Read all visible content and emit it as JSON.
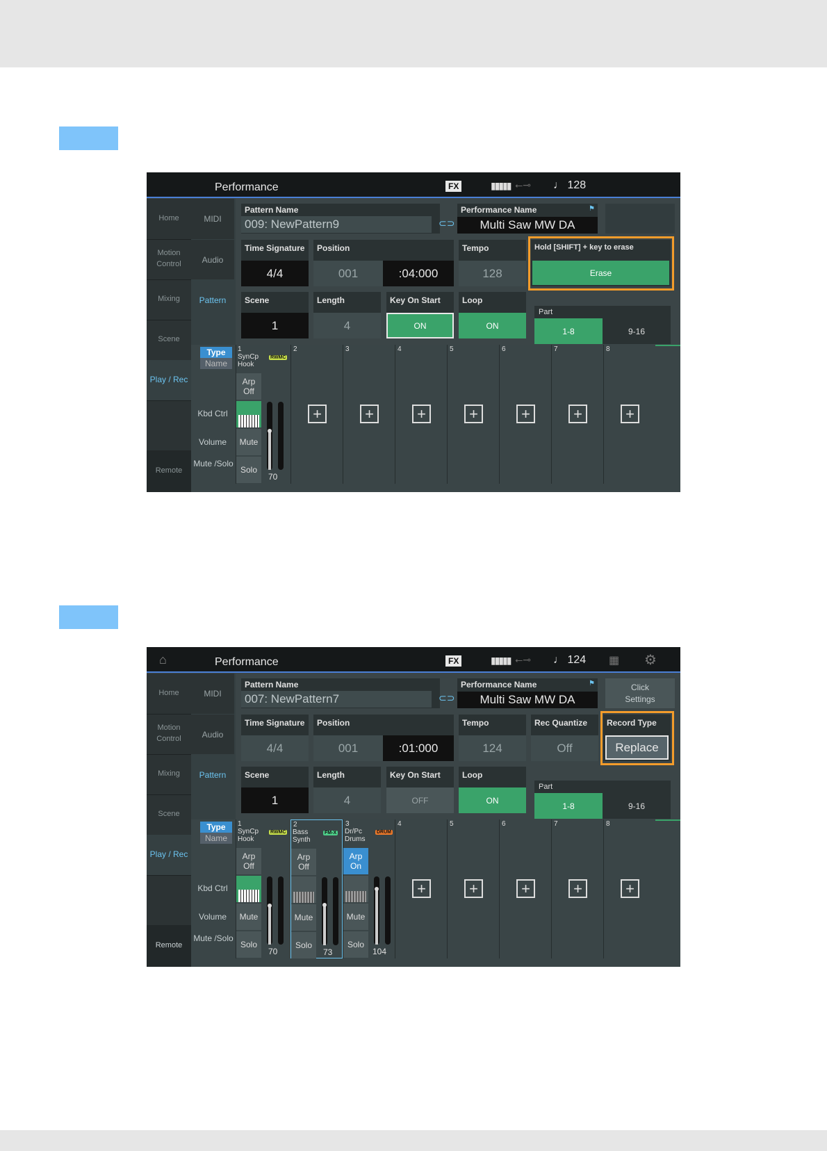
{
  "screen1": {
    "title": "Performance",
    "fx_label": "FX",
    "tempo_display": "♩ 128",
    "nav": [
      "Home",
      "Motion Control",
      "Mixing",
      "Scene",
      "Play / Rec",
      "Remote"
    ],
    "subnav": [
      "MIDI",
      "Audio",
      "Pattern"
    ],
    "pattern_name_label": "Pattern Name",
    "pattern_name": "009: NewPattern9",
    "performance_name_label": "Performance Name",
    "performance_name": "Multi Saw MW DA",
    "time_signature_label": "Time Signature",
    "time_signature": "4/4",
    "position_label": "Position",
    "position_measure": "001",
    "position_time": ":04:000",
    "tempo_label": "Tempo",
    "tempo": "128",
    "erase_hint": "Hold [SHIFT] + key to erase",
    "erase_button": "Erase",
    "scene_label": "Scene",
    "scene": "1",
    "length_label": "Length",
    "length": "4",
    "key_on_start_label": "Key On Start",
    "key_on_start": "ON",
    "loop_label": "Loop",
    "loop": "ON",
    "part_label": "Part",
    "part_1_8": "1-8",
    "part_9_16": "9-16",
    "type_label": "Type",
    "name_label": "Name",
    "row_labels": [
      "Kbd Ctrl",
      "Volume",
      "Mute /Solo"
    ],
    "part1": {
      "num": "1",
      "name": "SynCp Hook",
      "badge": "RWMC",
      "arp": "Arp Off",
      "mute": "Mute",
      "solo": "Solo",
      "volume": "70"
    },
    "empty_parts": [
      "2",
      "3",
      "4",
      "5",
      "6",
      "7",
      "8"
    ]
  },
  "screen2": {
    "title": "Performance",
    "fx_label": "FX",
    "tempo_display": "♩ 124",
    "nav": [
      "Home",
      "Motion Control",
      "Mixing",
      "Scene",
      "Play / Rec",
      "Remote"
    ],
    "subnav": [
      "MIDI",
      "Audio",
      "Pattern"
    ],
    "pattern_name_label": "Pattern Name",
    "pattern_name": "007: NewPattern7",
    "performance_name_label": "Performance Name",
    "performance_name": "Multi Saw MW DA",
    "click_settings": "Click Settings",
    "time_signature_label": "Time Signature",
    "time_signature": "4/4",
    "position_label": "Position",
    "position_measure": "001",
    "position_time": ":01:000",
    "tempo_label": "Tempo",
    "tempo": "124",
    "rec_quantize_label": "Rec Quantize",
    "rec_quantize": "Off",
    "record_type_label": "Record Type",
    "record_type": "Replace",
    "scene_label": "Scene",
    "scene": "1",
    "length_label": "Length",
    "length": "4",
    "key_on_start_label": "Key On Start",
    "key_on_start": "OFF",
    "loop_label": "Loop",
    "loop": "ON",
    "part_label": "Part",
    "part_1_8": "1-8",
    "part_9_16": "9-16",
    "type_label": "Type",
    "name_label": "Name",
    "row_labels": [
      "Kbd Ctrl",
      "Volume",
      "Mute /Solo"
    ],
    "parts": [
      {
        "num": "1",
        "name": "SynCp Hook",
        "badge": "RWMC",
        "arp": "Arp Off",
        "mute": "Mute",
        "solo": "Solo",
        "volume": "70"
      },
      {
        "num": "2",
        "name": "Bass Synth",
        "badge": "FM-X",
        "arp": "Arp Off",
        "mute": "Mute",
        "solo": "Solo",
        "volume": "73"
      },
      {
        "num": "3",
        "name": "Dr/Pc Drums",
        "badge": "DRUM",
        "arp": "Arp On",
        "mute": "Mute",
        "solo": "Solo",
        "volume": "104"
      }
    ],
    "empty_parts": [
      "4",
      "5",
      "6",
      "7",
      "8"
    ]
  }
}
